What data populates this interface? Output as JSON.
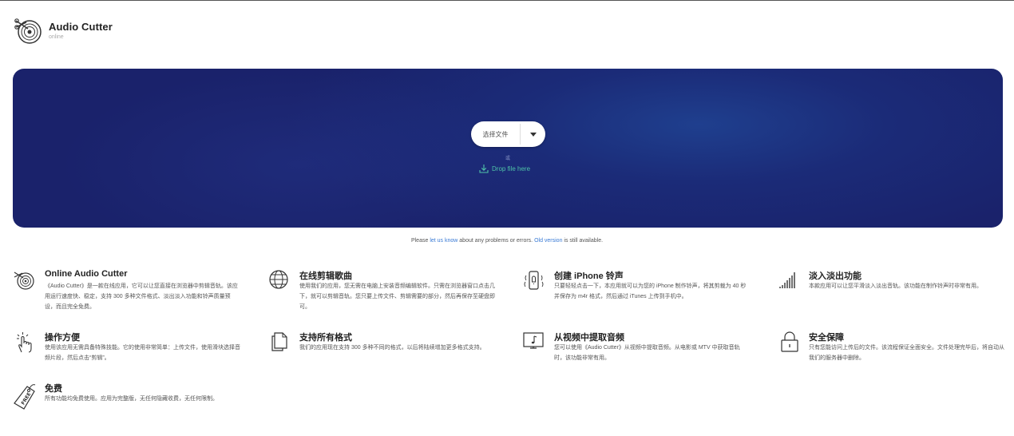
{
  "header": {
    "app_name": "Audio Cutter",
    "subtitle": "online",
    "logo_icon": "vinyl-scissors-icon"
  },
  "upload": {
    "choose_file_label": "选择文件",
    "dropdown_icon": "caret-down-icon",
    "or_text": "或",
    "drop_icon": "download-icon",
    "drop_text": "Drop file here",
    "accent_color": "#4fc3a8",
    "background_color": "#1b2b78"
  },
  "note": {
    "prefix": "Please ",
    "link1": "let us know",
    "middle": " about any problems or errors. ",
    "link2": "Old version",
    "suffix": " is still available."
  },
  "features": [
    {
      "icon": "vinyl-scissors-icon",
      "title": "Online Audio Cutter",
      "desc": "《Audio Cutter》是一款在线应用，它可以让您直接在浏览器中剪辑音轨。该应用运行速度快、稳定，支持 300 多种文件格式、淡出淡入功能和铃声质量预设，而且完全免费。"
    },
    {
      "icon": "globe-icon",
      "title": "在线剪辑歌曲",
      "desc": "使用我们的应用，您无需在电脑上安装音频编辑软件。只需在浏览器窗口点击几下，就可以剪辑音轨。您只要上传文件、剪辑需要的部分，然后再保存至硬盘即可。"
    },
    {
      "icon": "phone-ringtone-icon",
      "title": "创建 iPhone 铃声",
      "desc": "只要轻轻点击一下，本应用就可以为您的 iPhone 制作铃声，将其剪裁为 40 秒并保存为 m4r 格式，然后通过 iTunes 上传到手机中。"
    },
    {
      "icon": "fade-bars-icon",
      "title": "淡入淡出功能",
      "desc": "本款应用可以让您平滑淡入淡出音轨。该功能在制作铃声时非常有用。"
    },
    {
      "icon": "hand-click-icon",
      "title": "操作方便",
      "desc": "使用该应用无需具备特殊技能。它的使用非常简单：上传文件，使用滑块选择音频片段，然后点击“剪辑”。"
    },
    {
      "icon": "files-icon",
      "title": "支持所有格式",
      "desc": "我们的应用现在支持 300 多种不同的格式，以后将陆续增加更多格式支持。"
    },
    {
      "icon": "video-music-icon",
      "title": "从视频中提取音频",
      "desc": "您可以使用《Audio Cutter》从视频中提取音频。从电影或 MTV 中获取音轨时，该功能非常有用。"
    },
    {
      "icon": "lock-icon",
      "title": "安全保障",
      "desc": "只有您能访问上传后的文件。该流程保证全面安全。文件处理完毕后，将自动从我们的服务器中删除。"
    },
    {
      "icon": "free-tag-icon",
      "title": "免费",
      "desc": "所有功能均免费使用。应用为完整版，无任何隐藏收费，无任何限制。",
      "tag_text": "FREE"
    }
  ]
}
